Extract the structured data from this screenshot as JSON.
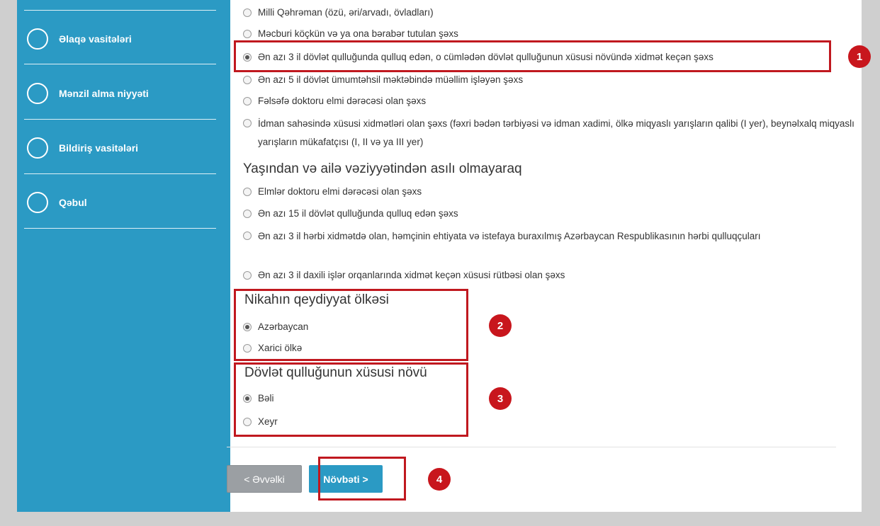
{
  "sidebar": {
    "items": [
      {
        "label": "Əlaqə vasitələri"
      },
      {
        "label": "Mənzil alma niyyəti"
      },
      {
        "label": "Bildiriş vasitələri"
      },
      {
        "label": "Qəbul"
      }
    ]
  },
  "section1": {
    "options": [
      {
        "label": "Milli Qəhrəman (özü, əri/arvadı, övladları)",
        "checked": false
      },
      {
        "label": "Məcburi köçkün və ya ona bərabər tutulan şəxs",
        "checked": false
      },
      {
        "label": "Ən azı 3 il dövlət qulluğunda qulluq edən, o cümlədən dövlət qulluğunun xüsusi növündə xidmət keçən şəxs",
        "checked": true
      },
      {
        "label": "Ən azı 5 il dövlət ümumtəhsil məktəbində müəllim işləyən şəxs",
        "checked": false
      },
      {
        "label": "Fəlsəfə doktoru elmi dərəcəsi olan şəxs",
        "checked": false
      },
      {
        "label": "İdman sahəsində xüsusi xidmətləri olan şəxs (fəxri bədən tərbiyəsi və idman xadimi, ölkə miqyaslı yarışların qalibi (I yer), beynəlxalq miqyaslı yarışların mükafatçısı (I, II və ya III yer)",
        "checked": false
      }
    ]
  },
  "section2": {
    "heading": "Yaşından və ailə vəziyyətindən asılı olmayaraq",
    "options": [
      {
        "label": "Elmlər doktoru elmi dərəcəsi olan şəxs",
        "checked": false
      },
      {
        "label": "Ən azı 15 il dövlət qulluğunda qulluq edən şəxs",
        "checked": false
      },
      {
        "label": "Ən azı 3 il hərbi xidmətdə olan, həmçinin ehtiyata və istefaya buraxılmış Azərbaycan Respublikasının hərbi qulluqçuları",
        "checked": false
      },
      {
        "label": "Ən azı 3 il daxili işlər orqanlarında xidmət keçən xüsusi rütbəsi olan şəxs",
        "checked": false
      }
    ]
  },
  "marriage": {
    "heading": "Nikahın qeydiyyat ölkəsi",
    "options": [
      {
        "label": "Azərbaycan",
        "checked": true
      },
      {
        "label": "Xarici ölkə",
        "checked": false
      }
    ]
  },
  "service_type": {
    "heading": "Dövlət qulluğunun xüsusi növü",
    "options": [
      {
        "label": "Bəli",
        "checked": true
      },
      {
        "label": "Xeyr",
        "checked": false
      }
    ]
  },
  "buttons": {
    "prev": "< Əvvəlki",
    "next": "Növbəti >"
  },
  "annotations": [
    "1",
    "2",
    "3",
    "4"
  ],
  "colors": {
    "sidebar": "#2b9ac4",
    "highlight": "#c0181f",
    "badge": "#c8161d",
    "prev_button": "#9b9fa3"
  }
}
